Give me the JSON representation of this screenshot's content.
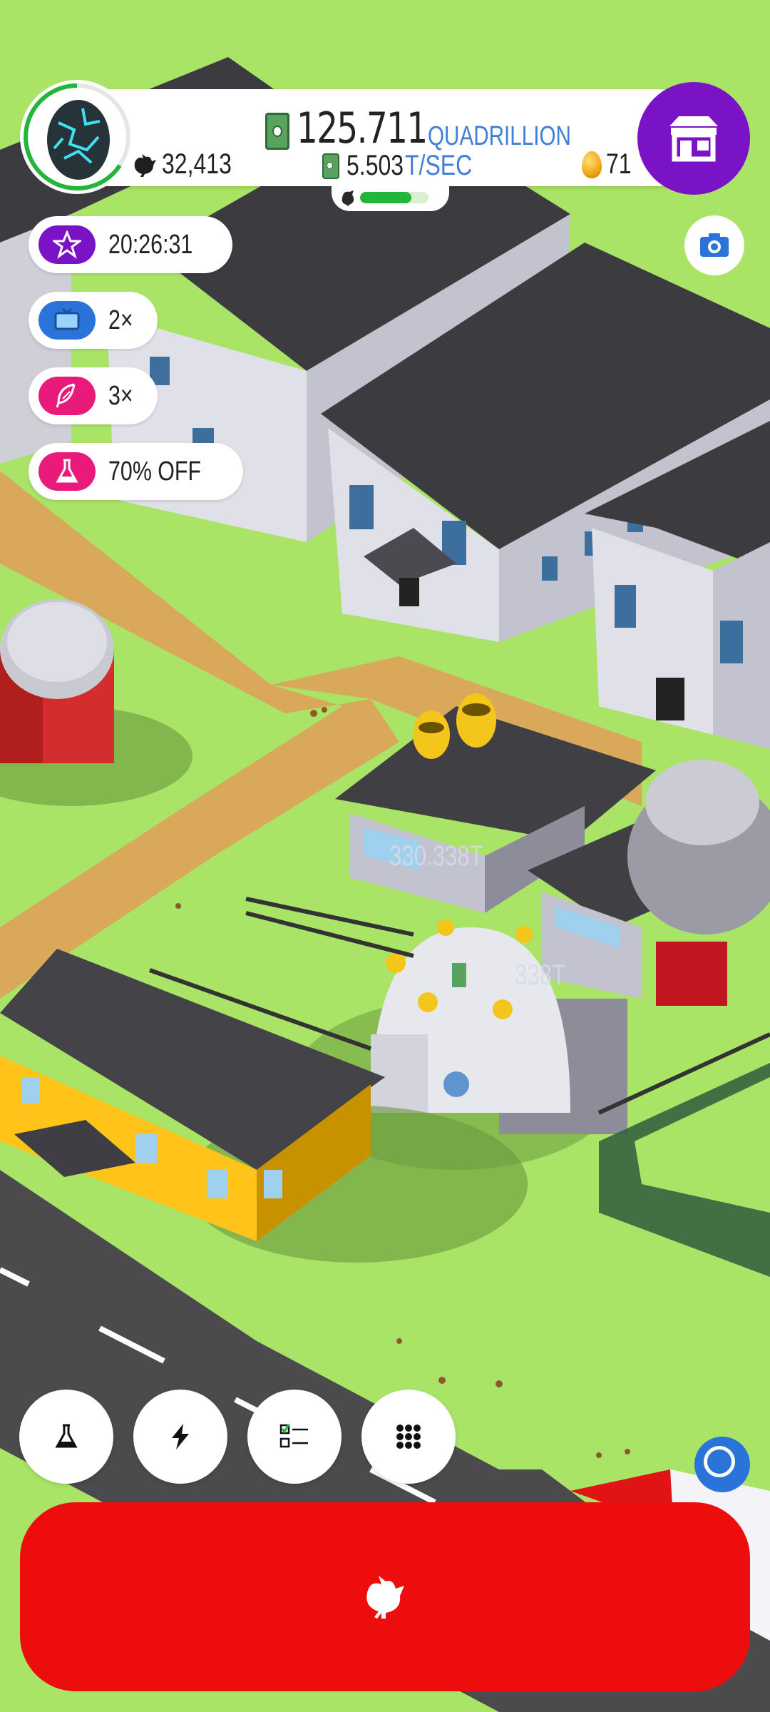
{
  "colors": {
    "grass": "#a9e466",
    "road": "#4b4b4e",
    "path": "#d9a85b",
    "shop_accent": "#7a12c6",
    "hatch_button": "#ee0d0d",
    "money_unit": "#3f7fd8",
    "progress": "#21b63a"
  },
  "header": {
    "money_value": "125.711",
    "money_unit": "QUADRILLION",
    "chicken_count": "32,413",
    "rate_value": "5.503",
    "rate_unit": "T/SEC",
    "golden_eggs": "71",
    "farm_progress": 0.75,
    "egg_icon": "cosmic-egg-icon",
    "shop_icon": "shop-icon",
    "camera_icon": "camera-icon"
  },
  "boosts": [
    {
      "label": "20:26:31",
      "icon": "star-icon",
      "color": "#7a12c6"
    },
    {
      "label": "2×",
      "icon": "video-icon",
      "color": "#2a73d9"
    },
    {
      "label": "3×",
      "icon": "feather-icon",
      "color": "#ea1a7b"
    },
    {
      "label": "70% OFF",
      "icon": "flask-icon",
      "color": "#ea1a7b"
    }
  ],
  "scene": {
    "shipping_label_1": "330.338T",
    "shipping_label_2": "338T"
  },
  "bottom": {
    "buttons": [
      {
        "name": "research-button",
        "icon": "flask-icon"
      },
      {
        "name": "boosts-button",
        "icon": "lightning-icon"
      },
      {
        "name": "missions-button",
        "icon": "checklist-icon"
      },
      {
        "name": "menu-button",
        "icon": "grid-icon"
      }
    ],
    "record_icon": "record-icon",
    "hatch_icon": "chicken-icon"
  }
}
